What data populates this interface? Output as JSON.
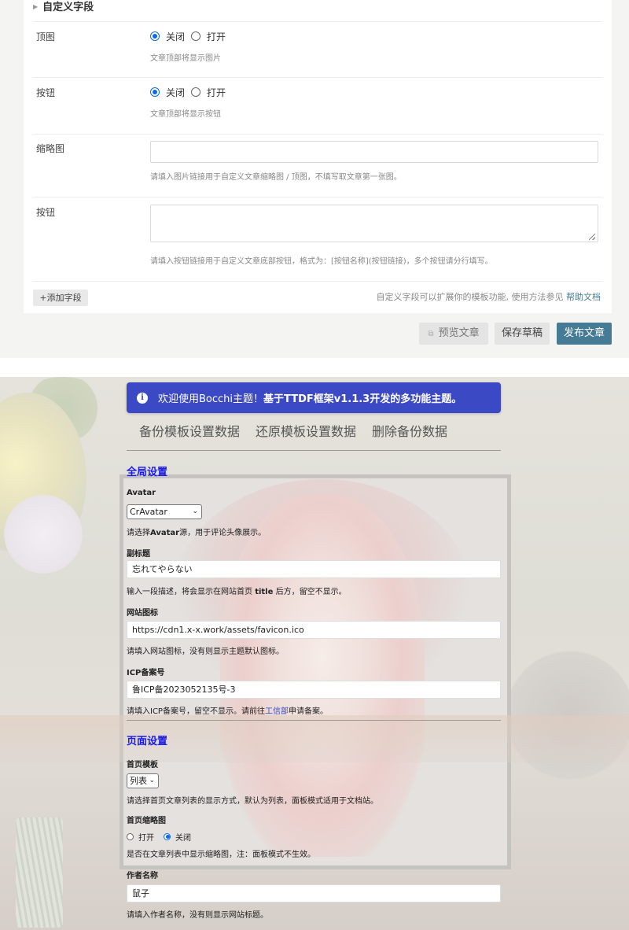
{
  "editor": {
    "section_title": "自定义字段",
    "fields": [
      {
        "label": "顶图",
        "type": "radio",
        "options": [
          "关闭",
          "打开"
        ],
        "selected": "关闭",
        "description": "文章顶部将显示图片"
      },
      {
        "label": "按钮",
        "type": "radio",
        "options": [
          "关闭",
          "打开"
        ],
        "selected": "关闭",
        "description": "文章顶部将显示按钮"
      },
      {
        "label": "缩略图",
        "type": "text",
        "value": "",
        "description": "请填入图片链接用于自定义文章缩略图 / 顶图，不填写取文章第一张图。"
      },
      {
        "label": "按钮",
        "type": "textarea",
        "value": "",
        "description": "请填入按钮链接用于自定义文章底部按钮，格式为：[按钮名称](按钮链接)，多个按钮请分行填写。"
      }
    ],
    "add_field_label": "+添加字段",
    "extension_note": "自定义字段可以扩展你的模板功能, 使用方法参见",
    "help_link": "帮助文档",
    "preview_label": "预览文章",
    "save_draft_label": "保存草稿",
    "publish_label": "发布文章",
    "accent_color": "#467b96"
  },
  "theme": {
    "notice": {
      "prefix": "欢迎使用Bocchi主题！",
      "bold": "基于TTDF框架v1.1.3开发的多功能主题。"
    },
    "tabs": [
      "备份模板设置数据",
      "还原模板设置数据",
      "删除备份数据"
    ],
    "global": {
      "title": "全局设置",
      "avatar": {
        "label": "Avatar",
        "value": "CrAvatar",
        "desc_a": "请选择",
        "desc_b": "Avatar",
        "desc_c": "源，用于评论头像展示。"
      },
      "subtitle": {
        "label": "副标题",
        "value": "忘れてやらない",
        "desc_a": "输入一段描述，将会显示在网站首页 ",
        "desc_b": "title",
        "desc_c": " 后方，留空不显示。"
      },
      "favicon": {
        "label": "网站图标",
        "value": "https://cdn1.x-x.work/assets/favicon.ico",
        "desc": "请填入网站图标，没有则显示主题默认图标。"
      },
      "icp": {
        "label": "ICP备案号",
        "value": "鲁ICP备2023052135号-3",
        "desc_a": "请填入ICP备案号，留空不显示。请前往",
        "desc_link": "工信部",
        "desc_b": "申请备案。"
      }
    },
    "page": {
      "title": "页面设置",
      "home_template": {
        "label": "首页模板",
        "value": "列表",
        "desc": "请选择首页文章列表的显示方式，默认为列表，面板模式适用于文档站。"
      },
      "home_thumb": {
        "label": "首页缩略图",
        "options": [
          "打开",
          "关闭"
        ],
        "selected": "关闭",
        "desc": "是否在文章列表中显示缩略图，注：面板模式不生效。"
      },
      "author": {
        "label": "作者名称",
        "value": "鼠子",
        "desc": "请填入作者名称，没有则显示网站标题。"
      }
    },
    "notice_color": "#3b49c4",
    "group_title_color": "#1a1aee"
  }
}
